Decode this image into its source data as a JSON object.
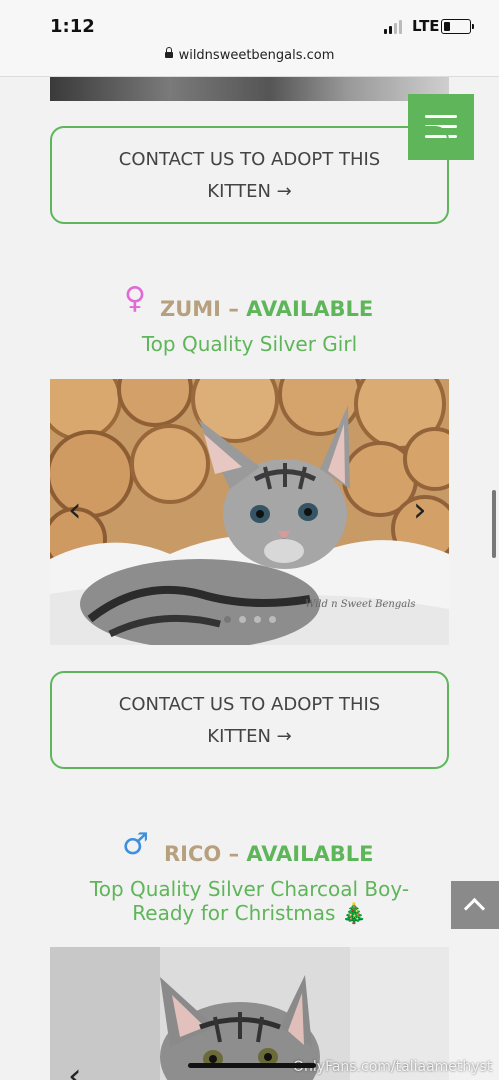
{
  "status": {
    "time": "1:12",
    "network": "LTE"
  },
  "browser": {
    "url": "wildnsweetbengals.com"
  },
  "contact_label_line1": "CONTACT US TO ADOPT THIS",
  "contact_label_line2": "KITTEN →",
  "kittens": [
    {
      "gender_symbol": "♀",
      "name": "ZUMI",
      "separator": "–",
      "status": "AVAILABLE",
      "subtitle": "Top Quality Silver Girl",
      "watermark": "Wild n Sweet Bengals"
    },
    {
      "gender_symbol": "♂",
      "name": "RICO",
      "separator": "–",
      "status": "AVAILABLE",
      "subtitle_line1": "Top Quality Silver Charcoal Boy-",
      "subtitle_line2": "Ready for Christmas 🎄"
    }
  ],
  "slider": {
    "prev_symbol": "‹",
    "next_symbol": "›"
  },
  "overlay": {
    "text": "OnlyFans.com/taliaamethyst"
  },
  "colors": {
    "accent": "#5fb55a",
    "name": "#b7a07e",
    "female": "#e06ad6",
    "male": "#3d8fe0"
  }
}
